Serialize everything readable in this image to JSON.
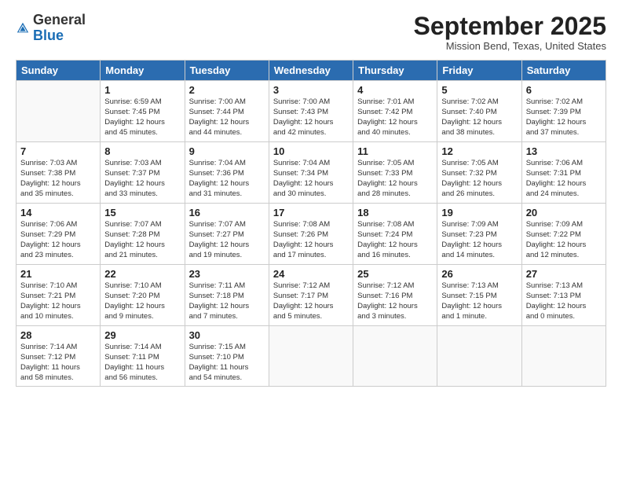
{
  "header": {
    "logo_general": "General",
    "logo_blue": "Blue",
    "month_title": "September 2025",
    "location": "Mission Bend, Texas, United States"
  },
  "days_of_week": [
    "Sunday",
    "Monday",
    "Tuesday",
    "Wednesday",
    "Thursday",
    "Friday",
    "Saturday"
  ],
  "weeks": [
    [
      {
        "day": "",
        "info": ""
      },
      {
        "day": "1",
        "info": "Sunrise: 6:59 AM\nSunset: 7:45 PM\nDaylight: 12 hours\nand 45 minutes."
      },
      {
        "day": "2",
        "info": "Sunrise: 7:00 AM\nSunset: 7:44 PM\nDaylight: 12 hours\nand 44 minutes."
      },
      {
        "day": "3",
        "info": "Sunrise: 7:00 AM\nSunset: 7:43 PM\nDaylight: 12 hours\nand 42 minutes."
      },
      {
        "day": "4",
        "info": "Sunrise: 7:01 AM\nSunset: 7:42 PM\nDaylight: 12 hours\nand 40 minutes."
      },
      {
        "day": "5",
        "info": "Sunrise: 7:02 AM\nSunset: 7:40 PM\nDaylight: 12 hours\nand 38 minutes."
      },
      {
        "day": "6",
        "info": "Sunrise: 7:02 AM\nSunset: 7:39 PM\nDaylight: 12 hours\nand 37 minutes."
      }
    ],
    [
      {
        "day": "7",
        "info": "Sunrise: 7:03 AM\nSunset: 7:38 PM\nDaylight: 12 hours\nand 35 minutes."
      },
      {
        "day": "8",
        "info": "Sunrise: 7:03 AM\nSunset: 7:37 PM\nDaylight: 12 hours\nand 33 minutes."
      },
      {
        "day": "9",
        "info": "Sunrise: 7:04 AM\nSunset: 7:36 PM\nDaylight: 12 hours\nand 31 minutes."
      },
      {
        "day": "10",
        "info": "Sunrise: 7:04 AM\nSunset: 7:34 PM\nDaylight: 12 hours\nand 30 minutes."
      },
      {
        "day": "11",
        "info": "Sunrise: 7:05 AM\nSunset: 7:33 PM\nDaylight: 12 hours\nand 28 minutes."
      },
      {
        "day": "12",
        "info": "Sunrise: 7:05 AM\nSunset: 7:32 PM\nDaylight: 12 hours\nand 26 minutes."
      },
      {
        "day": "13",
        "info": "Sunrise: 7:06 AM\nSunset: 7:31 PM\nDaylight: 12 hours\nand 24 minutes."
      }
    ],
    [
      {
        "day": "14",
        "info": "Sunrise: 7:06 AM\nSunset: 7:29 PM\nDaylight: 12 hours\nand 23 minutes."
      },
      {
        "day": "15",
        "info": "Sunrise: 7:07 AM\nSunset: 7:28 PM\nDaylight: 12 hours\nand 21 minutes."
      },
      {
        "day": "16",
        "info": "Sunrise: 7:07 AM\nSunset: 7:27 PM\nDaylight: 12 hours\nand 19 minutes."
      },
      {
        "day": "17",
        "info": "Sunrise: 7:08 AM\nSunset: 7:26 PM\nDaylight: 12 hours\nand 17 minutes."
      },
      {
        "day": "18",
        "info": "Sunrise: 7:08 AM\nSunset: 7:24 PM\nDaylight: 12 hours\nand 16 minutes."
      },
      {
        "day": "19",
        "info": "Sunrise: 7:09 AM\nSunset: 7:23 PM\nDaylight: 12 hours\nand 14 minutes."
      },
      {
        "day": "20",
        "info": "Sunrise: 7:09 AM\nSunset: 7:22 PM\nDaylight: 12 hours\nand 12 minutes."
      }
    ],
    [
      {
        "day": "21",
        "info": "Sunrise: 7:10 AM\nSunset: 7:21 PM\nDaylight: 12 hours\nand 10 minutes."
      },
      {
        "day": "22",
        "info": "Sunrise: 7:10 AM\nSunset: 7:20 PM\nDaylight: 12 hours\nand 9 minutes."
      },
      {
        "day": "23",
        "info": "Sunrise: 7:11 AM\nSunset: 7:18 PM\nDaylight: 12 hours\nand 7 minutes."
      },
      {
        "day": "24",
        "info": "Sunrise: 7:12 AM\nSunset: 7:17 PM\nDaylight: 12 hours\nand 5 minutes."
      },
      {
        "day": "25",
        "info": "Sunrise: 7:12 AM\nSunset: 7:16 PM\nDaylight: 12 hours\nand 3 minutes."
      },
      {
        "day": "26",
        "info": "Sunrise: 7:13 AM\nSunset: 7:15 PM\nDaylight: 12 hours\nand 1 minute."
      },
      {
        "day": "27",
        "info": "Sunrise: 7:13 AM\nSunset: 7:13 PM\nDaylight: 12 hours\nand 0 minutes."
      }
    ],
    [
      {
        "day": "28",
        "info": "Sunrise: 7:14 AM\nSunset: 7:12 PM\nDaylight: 11 hours\nand 58 minutes."
      },
      {
        "day": "29",
        "info": "Sunrise: 7:14 AM\nSunset: 7:11 PM\nDaylight: 11 hours\nand 56 minutes."
      },
      {
        "day": "30",
        "info": "Sunrise: 7:15 AM\nSunset: 7:10 PM\nDaylight: 11 hours\nand 54 minutes."
      },
      {
        "day": "",
        "info": ""
      },
      {
        "day": "",
        "info": ""
      },
      {
        "day": "",
        "info": ""
      },
      {
        "day": "",
        "info": ""
      }
    ]
  ]
}
